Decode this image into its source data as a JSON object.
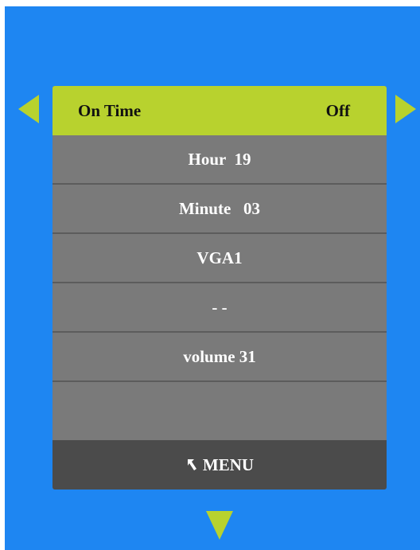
{
  "header": {
    "title": "On Time",
    "status": "Off"
  },
  "rows": [
    {
      "label": "Hour  19"
    },
    {
      "label": "Minute   03"
    },
    {
      "label": "VGA1"
    },
    {
      "label": "- -"
    },
    {
      "label": "volume 31"
    },
    {
      "label": ""
    }
  ],
  "footer": {
    "menu_label": "MENU"
  },
  "colors": {
    "background": "#1e86f2",
    "accent": "#b8d22e",
    "row": "#7a7a7a",
    "footer": "#4b4b4b"
  },
  "icons": {
    "left": "triangle-left-icon",
    "right": "triangle-right-icon",
    "down": "triangle-down-icon",
    "menu": "return-arrow-icon"
  }
}
